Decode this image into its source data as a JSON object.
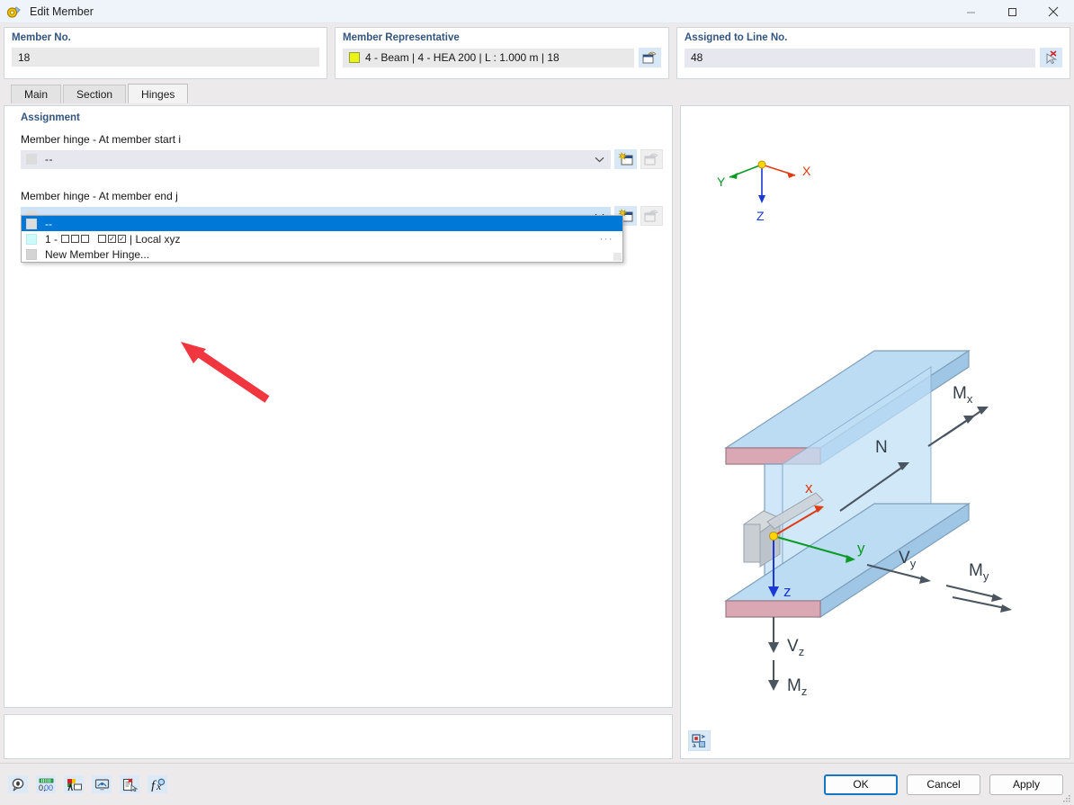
{
  "window": {
    "title": "Edit Member",
    "icon": "member-hinge-icon",
    "controls": {
      "minimize": "—",
      "maximize": "☐",
      "close": "✕"
    }
  },
  "header": {
    "member_no": {
      "title": "Member No.",
      "value": "18"
    },
    "member_representative": {
      "title": "Member Representative",
      "value": "4 - Beam | 4 - HEA 200 | L : 1.000 m | 18",
      "swatch_color": "#eaf514",
      "button_icon": "select-member-icon"
    },
    "assigned_to_line_no": {
      "title": "Assigned to Line No.",
      "value": "48",
      "button_icon": "deselect-line-icon"
    }
  },
  "tabs": [
    {
      "label": "Main",
      "active": false
    },
    {
      "label": "Section",
      "active": false
    },
    {
      "label": "Hinges",
      "active": true
    }
  ],
  "assignment": {
    "title": "Assignment",
    "start": {
      "label": "Member hinge - At member start i",
      "value": "--",
      "swatch_color": "#dcdcdc",
      "new_button_icon": "new-member-hinge-icon",
      "edit_button_icon": "edit-member-hinge-icon"
    },
    "end": {
      "label": "Member hinge - At member end j",
      "value": "--",
      "swatch_color": "#dcdcdc",
      "new_button_icon": "new-member-hinge-icon",
      "edit_button_icon": "edit-member-hinge-icon",
      "expanded": true
    },
    "dropdown": {
      "items": [
        {
          "label": "--",
          "swatch": "grey",
          "selected": true,
          "ellipsis": false
        },
        {
          "label": "1 -",
          "suffix": "| Local xyz",
          "swatch": "cyan",
          "selected": false,
          "ellipsis": true,
          "checkboxes": [
            false,
            false,
            false,
            false,
            true,
            true
          ]
        },
        {
          "label": "New Member Hinge...",
          "swatch": "grey2",
          "selected": false,
          "ellipsis": false
        }
      ],
      "ellipsis_text": "···"
    }
  },
  "viewer": {
    "global_axes": [
      {
        "label": "X",
        "color": "#e03a10"
      },
      {
        "label": "Y",
        "color": "#0a9a25"
      },
      {
        "label": "Z",
        "color": "#1a39d4"
      }
    ],
    "local_axes": [
      {
        "label": "x",
        "color": "#e03a10"
      },
      {
        "label": "y",
        "color": "#0a9a25"
      },
      {
        "label": "z",
        "color": "#1a39d4"
      }
    ],
    "force_labels": [
      "N",
      "M",
      "V",
      "V",
      "M",
      "M"
    ],
    "annotations": [
      {
        "base": "M",
        "sub": "x"
      },
      {
        "base": "N",
        "sub": ""
      },
      {
        "base": "V",
        "sub": "y"
      },
      {
        "base": "M",
        "sub": "y"
      },
      {
        "base": "V",
        "sub": "z"
      },
      {
        "base": "M",
        "sub": "z"
      }
    ],
    "button_icon": "view-settings-icon",
    "flange_color": "#d9a8b4",
    "web_color": "#c4e0f5"
  },
  "footer": {
    "tools": [
      {
        "icon": "help-info-icon",
        "name": "comment-icon"
      },
      {
        "icon": "numeric-format-icon",
        "name": "decimal-places-icon"
      },
      {
        "icon": "text-graphic-icon",
        "name": "display-properties-icon"
      },
      {
        "icon": "render-view-icon",
        "name": "visibility-icon"
      },
      {
        "icon": "delete-note-icon",
        "name": "reset-icon"
      },
      {
        "icon": "formula-icon",
        "name": "function-icon"
      }
    ],
    "buttons": [
      {
        "label": "OK",
        "primary": true
      },
      {
        "label": "Cancel",
        "primary": false
      },
      {
        "label": "Apply",
        "primary": false
      }
    ]
  },
  "annotation_arrow": {
    "color": "#f0373f",
    "points_to": "hinge-list-item-1"
  }
}
